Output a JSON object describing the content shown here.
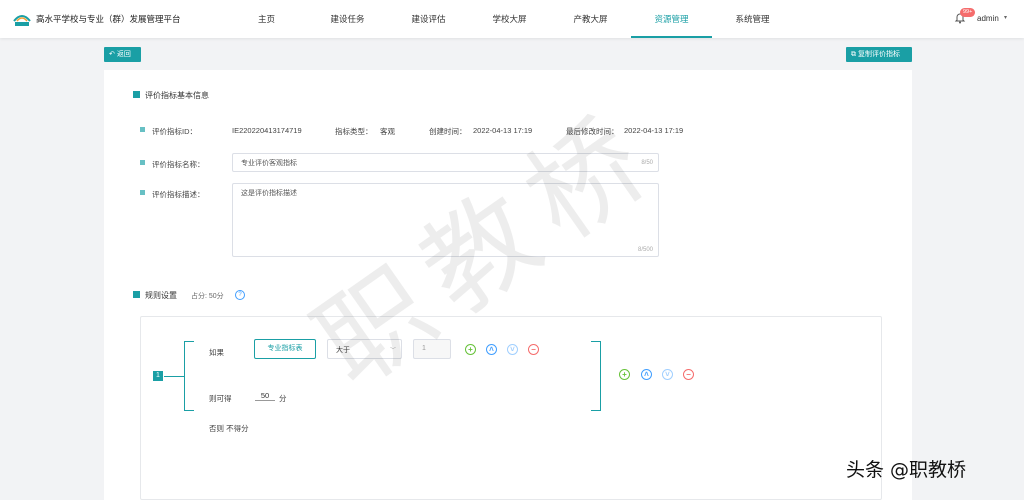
{
  "app": {
    "title": "高水平学校与专业（群）发展管理平台"
  },
  "nav": {
    "items": [
      {
        "label": "主页"
      },
      {
        "label": "建设任务"
      },
      {
        "label": "建设评估"
      },
      {
        "label": "学校大屏"
      },
      {
        "label": "产教大屏"
      },
      {
        "label": "资源管理"
      },
      {
        "label": "系统管理"
      }
    ],
    "active": "资源管理"
  },
  "header": {
    "notification_count": "99+",
    "username": "admin"
  },
  "toolbar": {
    "back_label": "返回",
    "copy_label": "复制评价指标"
  },
  "basic_info": {
    "section_title": "评价指标基本信息",
    "id_label": "评价指标ID：",
    "id_value": "IE220220413174719",
    "type_label": "指标类型：",
    "type_value": "客观",
    "created_label": "创建时间：",
    "created_value": "2022-04-13 17:19",
    "modified_label": "最后修改时间：",
    "modified_value": "2022-04-13 17:19",
    "name_label": "评价指标名称：",
    "name_value": "专业评价客观指标",
    "name_count": "8/50",
    "desc_label": "评价指标描述：",
    "desc_value": "这是评价指标描述",
    "desc_count": "8/500"
  },
  "rules": {
    "section_title": "规则设置",
    "score_label": "占分: 50分",
    "help": "?",
    "rule_number": "1",
    "if_label": "如果",
    "field_button": "专业指标表",
    "operator": "大于",
    "value": "1",
    "then_label": "则可得",
    "score_value": "50",
    "score_unit": "分",
    "else_label": "否则 不得分"
  },
  "watermark": {
    "center": "职教桥",
    "corner": "头条 @职教桥"
  },
  "colors": {
    "accent": "#1a9fa5",
    "add": "#67c23a",
    "move": "#409eff",
    "delete": "#f56c6c"
  }
}
